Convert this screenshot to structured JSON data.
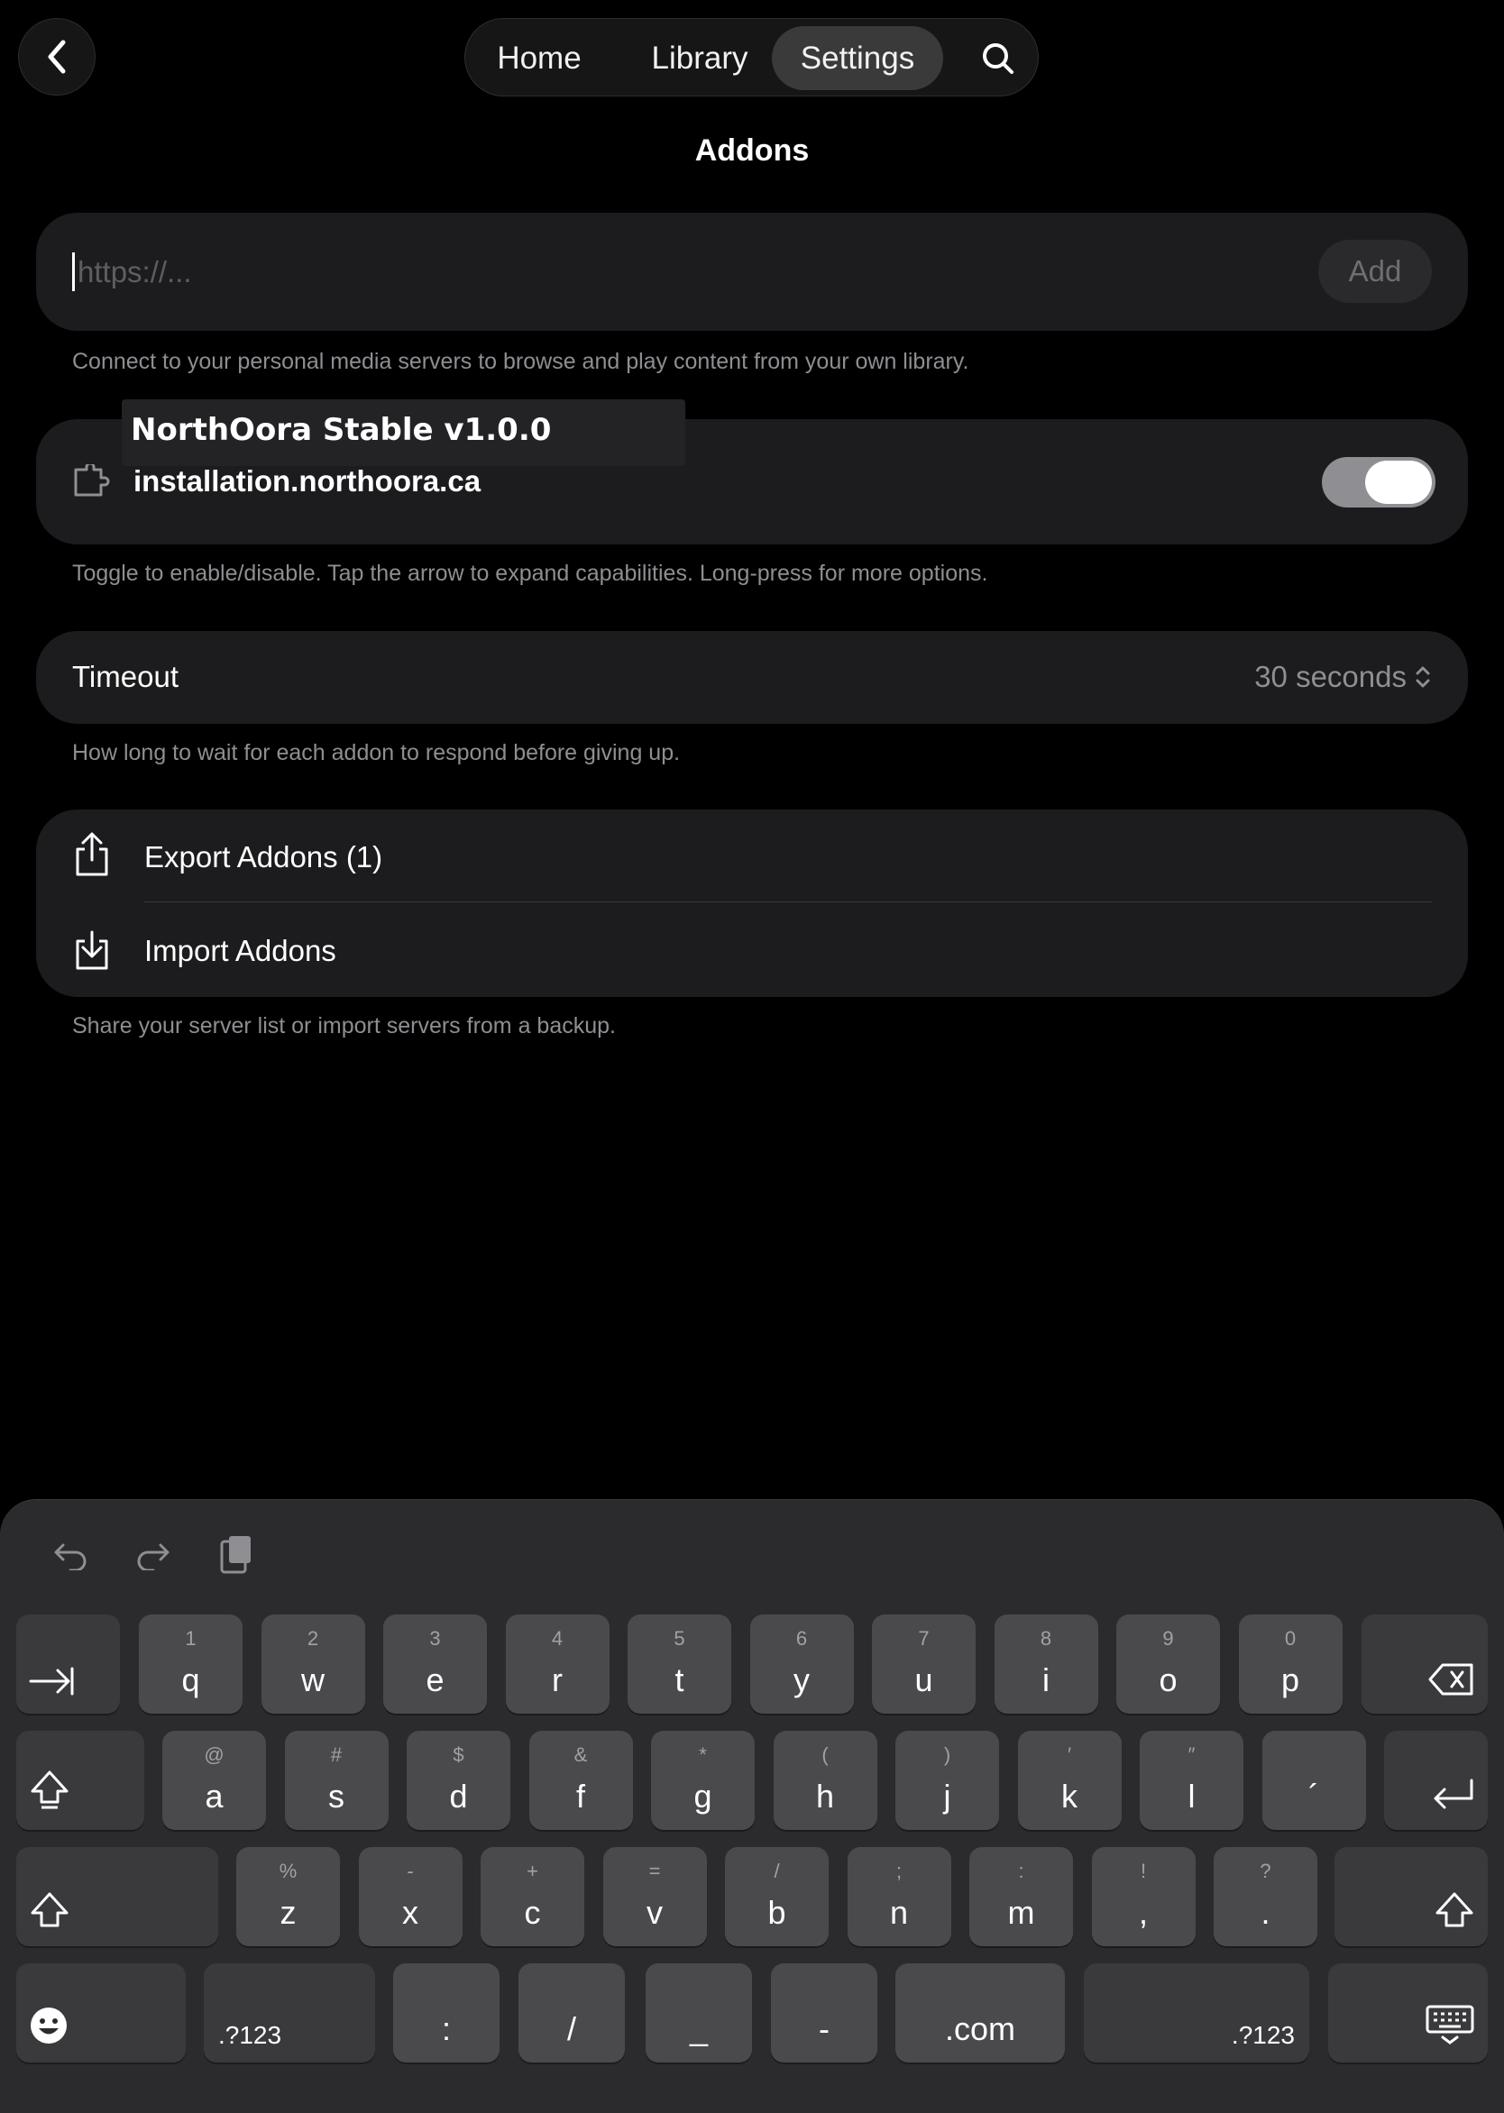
{
  "nav": {
    "tabs": [
      {
        "label": "Home",
        "active": false
      },
      {
        "label": "Library",
        "active": false
      },
      {
        "label": "Settings",
        "active": true
      }
    ],
    "search_icon": "search-icon",
    "back_icon": "chevron-left-icon"
  },
  "page": {
    "title": "Addons"
  },
  "url_field": {
    "placeholder": "https://...",
    "value": "",
    "add_label": "Add",
    "hint": "Connect to your personal media servers to browse and play content from your own library."
  },
  "addon": {
    "name": "NorthOora Stable v1.0.0",
    "url": "installation.northoora.ca",
    "icon": "puzzle-icon",
    "enabled": true,
    "hint": "Toggle to enable/disable. Tap the arrow to expand capabilities. Long-press for more options."
  },
  "timeout": {
    "label": "Timeout",
    "value": "30 seconds",
    "hint": "How long to wait for each addon to respond before giving up."
  },
  "io": {
    "export_label": "Export Addons (1)",
    "import_label": "Import Addons",
    "hint": "Share your server list or import servers from a backup."
  },
  "keyboard": {
    "toolbar": [
      "undo-icon",
      "redo-icon",
      "clipboard-icon"
    ],
    "row1": [
      {
        "sub": "1",
        "main": "q"
      },
      {
        "sub": "2",
        "main": "w"
      },
      {
        "sub": "3",
        "main": "e"
      },
      {
        "sub": "4",
        "main": "r"
      },
      {
        "sub": "5",
        "main": "t"
      },
      {
        "sub": "6",
        "main": "y"
      },
      {
        "sub": "7",
        "main": "u"
      },
      {
        "sub": "8",
        "main": "i"
      },
      {
        "sub": "9",
        "main": "o"
      },
      {
        "sub": "0",
        "main": "p"
      }
    ],
    "row2": [
      {
        "sub": "@",
        "main": "a"
      },
      {
        "sub": "#",
        "main": "s"
      },
      {
        "sub": "$",
        "main": "d"
      },
      {
        "sub": "&",
        "main": "f"
      },
      {
        "sub": "*",
        "main": "g"
      },
      {
        "sub": "(",
        "main": "h"
      },
      {
        "sub": ")",
        "main": "j"
      },
      {
        "sub": "′",
        "main": "k"
      },
      {
        "sub": "″",
        "main": "l"
      },
      {
        "sub": "",
        "main": "´"
      }
    ],
    "row3": [
      {
        "sub": "%",
        "main": "z"
      },
      {
        "sub": "-",
        "main": "x"
      },
      {
        "sub": "+",
        "main": "c"
      },
      {
        "sub": "=",
        "main": "v"
      },
      {
        "sub": "/",
        "main": "b"
      },
      {
        "sub": ";",
        "main": "n"
      },
      {
        "sub": ":",
        "main": "m"
      },
      {
        "sub": "!",
        "main": ","
      },
      {
        "sub": "?",
        "main": "."
      }
    ],
    "row4": {
      "numbers_left": ".?123",
      "colon": ":",
      "slash": "/",
      "underscore": "_",
      "dash": "-",
      "dotcom": ".com",
      "numbers_right": ".?123"
    }
  }
}
